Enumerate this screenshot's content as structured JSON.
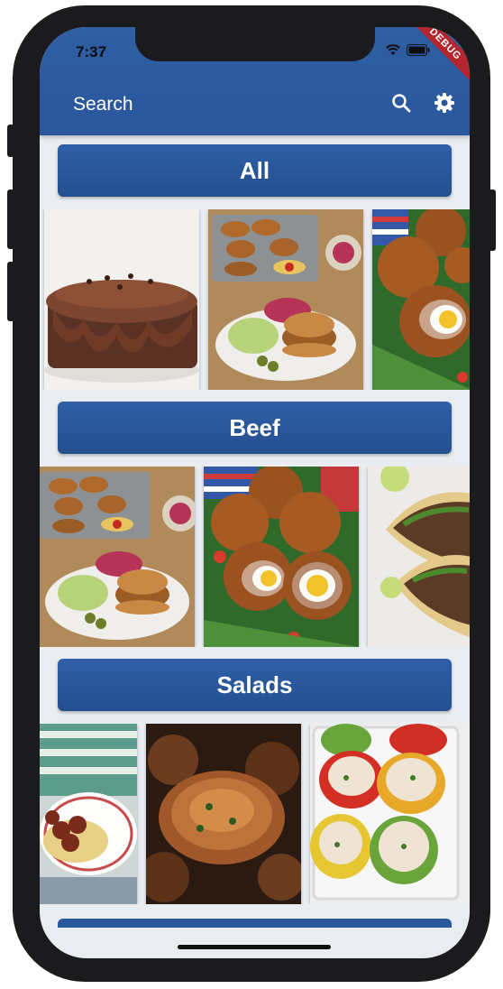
{
  "status_bar": {
    "time": "7:37",
    "debug_label": "DEBUG"
  },
  "app_bar": {
    "title": "Search",
    "search_icon": "search-icon",
    "settings_icon": "gear-icon"
  },
  "categories": [
    {
      "label": "All"
    },
    {
      "label": "Beef"
    },
    {
      "label": "Salads"
    }
  ],
  "colors": {
    "primary": "#2b579c",
    "background": "#e9edf1"
  }
}
